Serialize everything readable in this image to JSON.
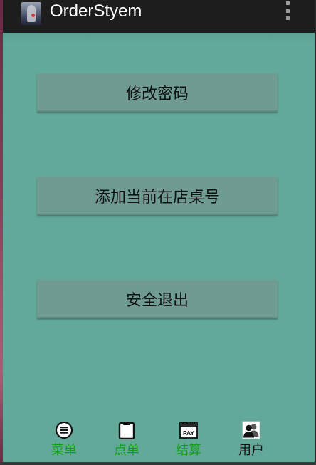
{
  "app": {
    "title": "OrderStyem"
  },
  "actions": [
    {
      "label": "修改密码"
    },
    {
      "label": "添加当前在店桌号"
    },
    {
      "label": "安全退出"
    }
  ],
  "tabs": [
    {
      "label": "菜单",
      "icon": "list-icon",
      "active_color": "#12a012"
    },
    {
      "label": "点单",
      "icon": "clipboard-icon",
      "active_color": "#12a012"
    },
    {
      "label": "结算",
      "icon": "pay-icon",
      "active_color": "#12a012"
    },
    {
      "label": "用户",
      "icon": "users-icon",
      "active_color": "#111111"
    }
  ],
  "colors": {
    "background": "#62a99a",
    "button": "#6f9b93",
    "actionbar": "#1d1d1d",
    "tab_green": "#12a012"
  }
}
